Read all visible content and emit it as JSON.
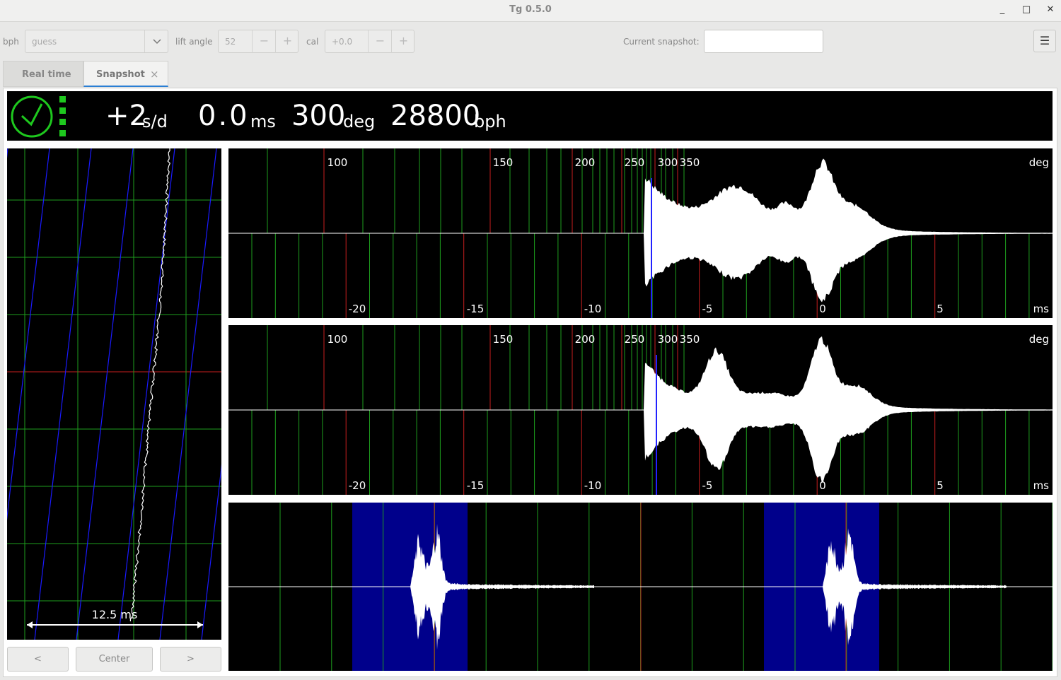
{
  "window": {
    "title": "Tg 0.5.0",
    "minimize": "_",
    "maximize": "□",
    "close": "✕"
  },
  "toolbar": {
    "bph_label": "bph",
    "bph_value": "guess",
    "lift_angle_label": "lift angle",
    "lift_angle_value": "52",
    "cal_label": "cal",
    "cal_value": "+0.0",
    "minus": "−",
    "plus": "+",
    "snapshot_label": "Current snapshot:",
    "snapshot_value": "",
    "menu_icon": "hamburger-menu-icon"
  },
  "tabs": [
    {
      "label": "Real time"
    },
    {
      "label": "Snapshot",
      "close": "×"
    }
  ],
  "status": {
    "rate": "+2",
    "rate_unit": "s/d",
    "beat_error": "0.0",
    "beat_error_unit": "ms",
    "amplitude": "300",
    "amplitude_unit": "deg",
    "bph": "28800",
    "bph_unit": "bph",
    "icon": "clock-ok-icon"
  },
  "paperstrip": {
    "scale_label": "12.5 ms"
  },
  "waveform": {
    "deg_ticks": [
      "100",
      "150",
      "200",
      "250",
      "300",
      "350"
    ],
    "deg_unit": "deg",
    "ms_ticks": [
      "-20",
      "-15",
      "-10",
      "-5",
      "0",
      "5"
    ],
    "ms_unit": "ms"
  },
  "buttons": {
    "prev": "<",
    "center": "Center",
    "next": ">"
  },
  "colors": {
    "grid": "#1e9e1e",
    "marker": "#c81e1e",
    "trace": "#ffffff",
    "accent": "#2a7fd4",
    "highlight": "#00008b"
  }
}
